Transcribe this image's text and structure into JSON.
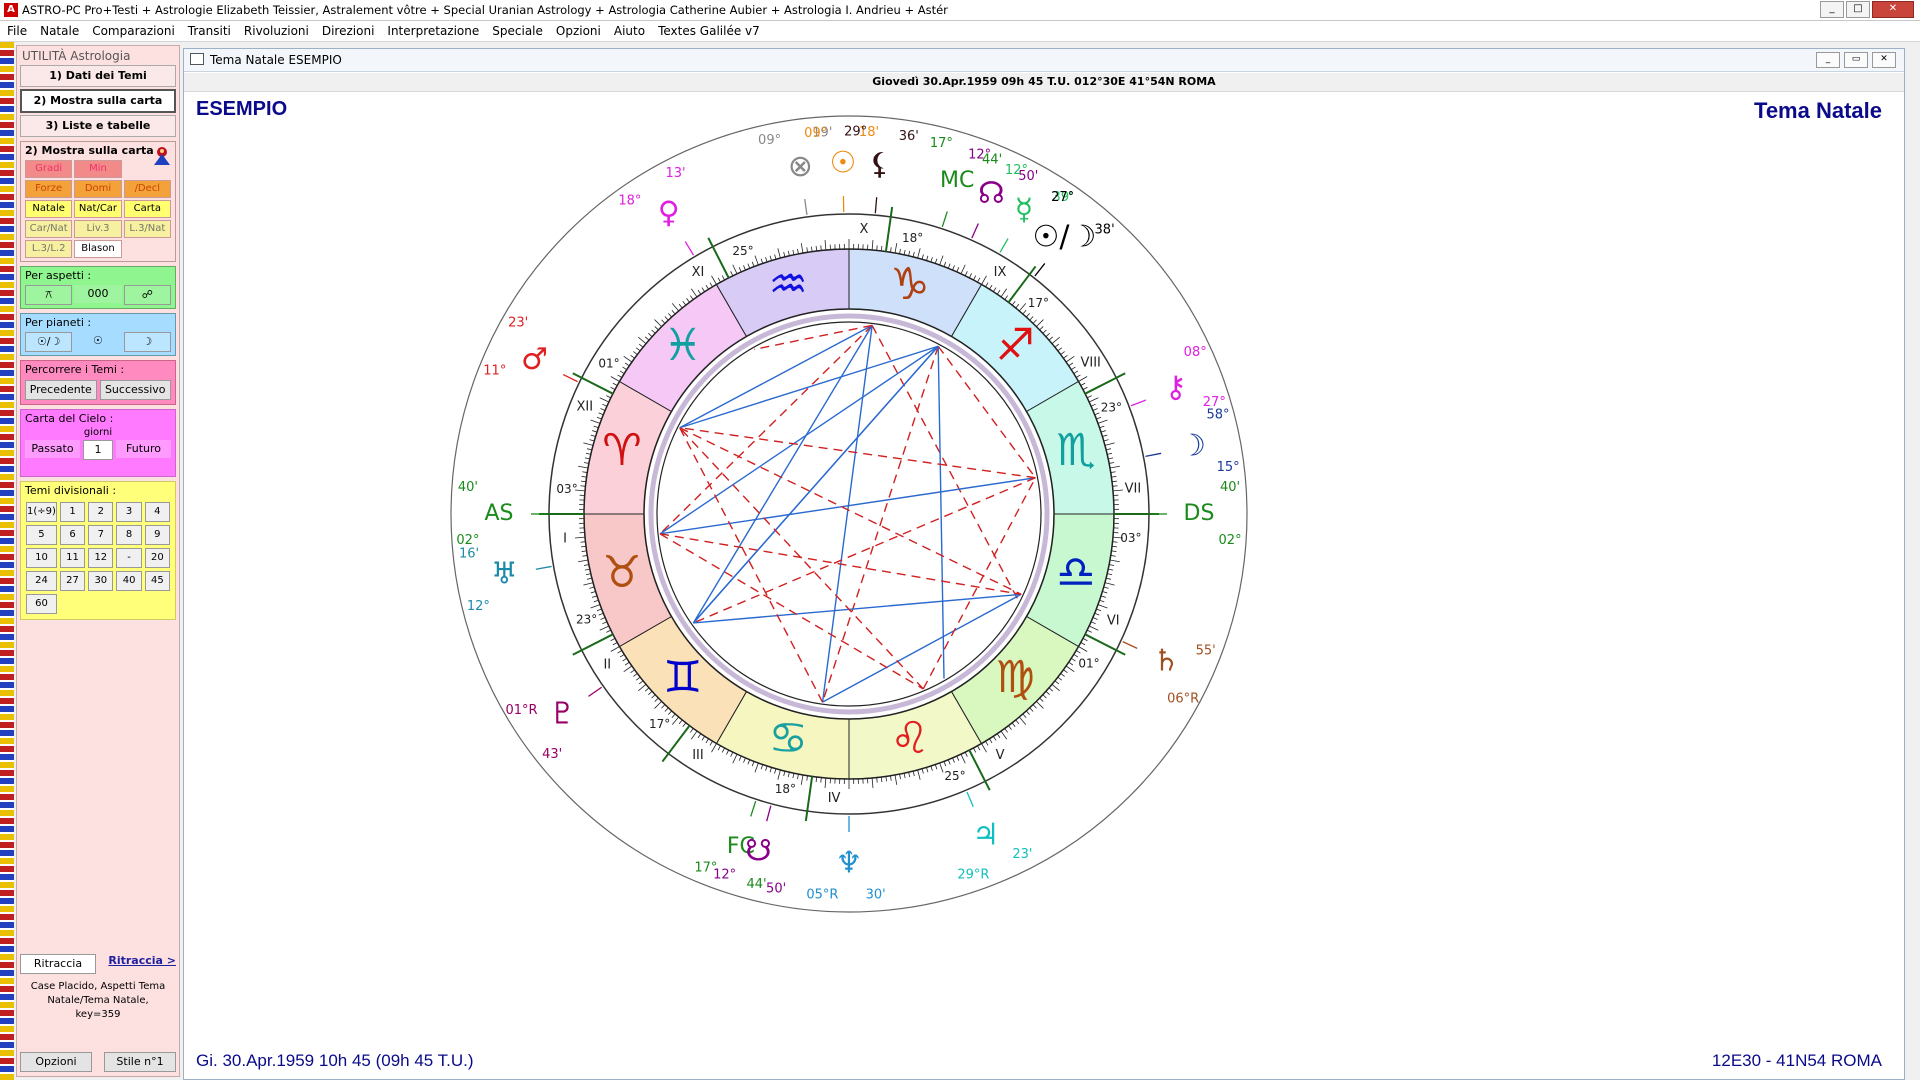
{
  "window": {
    "title": "ASTRO-PC Pro+Testi + Astrologie Elizabeth Teissier, Astralement vôtre + Special Uranian Astrology + Astrologia Catherine Aubier + Astrologia I. Andrieu + Astér",
    "controls": [
      "_",
      "□",
      "✕"
    ]
  },
  "menu": [
    {
      "label": "File"
    },
    {
      "label": "Natale"
    },
    {
      "label": "Comparazioni"
    },
    {
      "label": "Transiti"
    },
    {
      "label": "Rivoluzioni"
    },
    {
      "label": "Direzioni"
    },
    {
      "label": "Interpretazione"
    },
    {
      "label": "Speciale"
    },
    {
      "label": "Opzioni"
    },
    {
      "label": "Aiuto"
    },
    {
      "label": "Textes Galilée v7"
    }
  ],
  "sidebar": {
    "heading": "UTILITÀ Astrologia",
    "nav": [
      "1) Dati dei Temi",
      "2) Mostra sulla carta",
      "3) Liste e tabelle"
    ],
    "show_group_title": "2) Mostra sulla carta :",
    "show_buttons": [
      {
        "label": "Gradi",
        "style": "r"
      },
      {
        "label": "Min",
        "style": "r"
      },
      {
        "label": "",
        "style": "none"
      },
      {
        "label": "Forze",
        "style": "o"
      },
      {
        "label": "Domi",
        "style": "o"
      },
      {
        "label": "/Decl",
        "style": "o"
      },
      {
        "label": "Natale",
        "style": "y"
      },
      {
        "label": "Nat/Car",
        "style": "y"
      },
      {
        "label": "Carta",
        "style": "y"
      },
      {
        "label": "Car/Nat",
        "style": "yy"
      },
      {
        "label": "Liv.3",
        "style": "yy"
      },
      {
        "label": "L.3/Nat",
        "style": "yy"
      },
      {
        "label": "L.3/L.2",
        "style": "yy"
      },
      {
        "label": "Blason",
        "style": "w"
      },
      {
        "label": "",
        "style": "none"
      }
    ],
    "aspects": {
      "title": "Per aspetti :",
      "buttons": [
        "⚻",
        "000",
        "☍"
      ]
    },
    "planets": {
      "title": "Per pianeti :",
      "buttons": [
        "☉/☽",
        "☉",
        "☽"
      ]
    },
    "browse": {
      "title": "Percorrere i Temi :",
      "prev": "Precedente",
      "next": "Successivo"
    },
    "sky": {
      "title": "Carta del Cielo :",
      "unit": "giorni",
      "past": "Passato",
      "value": "1",
      "future": "Futuro"
    },
    "divisional": {
      "title": "Temi divisionali :",
      "buttons": [
        "1(÷9)",
        "1",
        "2",
        "3",
        "4",
        "5",
        "6",
        "7",
        "8",
        "9",
        "10",
        "11",
        "12",
        "-",
        "20",
        "24",
        "27",
        "30",
        "40",
        "45",
        "60"
      ]
    },
    "retrace": {
      "button": "Ritraccia",
      "link": "Ritraccia >"
    },
    "status": "Case Placido, Aspetti Tema Natale/Tema Natale, key=359",
    "options": "Opzioni",
    "style": "Stile n°1"
  },
  "chart_window": {
    "title": "Tema Natale  ESEMPIO",
    "info": "Giovedì 30.Apr.1959 09h 45 T.U. 012°30E 41°54N  ROMA",
    "name": "ESEMPIO",
    "type_label": "Tema Natale",
    "date_line": "Gi. 30.Apr.1959 10h 45 (09h 45 T.U.)",
    "coords": "12E30 - 41N54  ROMA"
  },
  "chart_data": {
    "type": "natal_wheel",
    "ascendant_deg": 122.67,
    "signs": [
      {
        "name": "Leone",
        "glyph": "♌",
        "color": "#e02020",
        "fill": "#f2f8c8"
      },
      {
        "name": "Cancro",
        "glyph": "♋",
        "color": "#1aa0a0",
        "fill": "#f6f6c0"
      },
      {
        "name": "Gemelli",
        "glyph": "♊",
        "color": "#0000cc",
        "fill": "#fbe1b8"
      },
      {
        "name": "Toro",
        "glyph": "♉",
        "color": "#b05010",
        "fill": "#f8c8c8"
      },
      {
        "name": "Ariete",
        "glyph": "♈",
        "color": "#d01010",
        "fill": "#fbd0d8"
      },
      {
        "name": "Pesci",
        "glyph": "♓",
        "color": "#11a0a0",
        "fill": "#f5c8f5"
      },
      {
        "name": "Acquario",
        "glyph": "♒",
        "color": "#1010e0",
        "fill": "#d8cbf5"
      },
      {
        "name": "Capricorno",
        "glyph": "♑",
        "color": "#b04010",
        "fill": "#cfe0fb"
      },
      {
        "name": "Sagittario",
        "glyph": "♐",
        "color": "#e01010",
        "fill": "#c9f3fb"
      },
      {
        "name": "Scorpione",
        "glyph": "♏",
        "color": "#11a0a0",
        "fill": "#c8f8e8"
      },
      {
        "name": "Bilancia",
        "glyph": "♎",
        "color": "#0020c0",
        "fill": "#c8f8d0"
      },
      {
        "name": "Vergine",
        "glyph": "♍",
        "color": "#b05010",
        "fill": "#d8f8c0"
      }
    ],
    "house_cusps": [
      {
        "label": "I",
        "angle": 180,
        "deg": "03°"
      },
      {
        "label": "II",
        "angle": 207,
        "deg": "23°"
      },
      {
        "label": "III",
        "angle": 233,
        "deg": "17°"
      },
      {
        "label": "IV",
        "angle": 262,
        "deg": "18°"
      },
      {
        "label": "V",
        "angle": 297,
        "deg": "25°"
      },
      {
        "label": "VI",
        "angle": 333,
        "deg": "01°"
      },
      {
        "label": "VII",
        "angle": 0,
        "deg": "03°"
      },
      {
        "label": "VIII",
        "angle": 27,
        "deg": "23°"
      },
      {
        "label": "IX",
        "angle": 53,
        "deg": "17°"
      },
      {
        "label": "X",
        "angle": 82,
        "deg": "18°"
      },
      {
        "label": "XI",
        "angle": 117,
        "deg": "25°"
      },
      {
        "label": "XII",
        "angle": 153,
        "deg": "01°"
      }
    ],
    "planets": [
      {
        "name": "Ascendente",
        "glyph": "AS",
        "angle": 180,
        "deg": "02°",
        "min": "40'",
        "color": "#1a8a1a"
      },
      {
        "name": "Discendente",
        "glyph": "DS",
        "angle": 0,
        "deg": "40'",
        "min": "02°",
        "color": "#1a8a1a"
      },
      {
        "name": "Medio Cielo",
        "glyph": "MC",
        "angle": 72,
        "deg": "17°",
        "min": "44'",
        "color": "#1a8a1a"
      },
      {
        "name": "Fondo Cielo",
        "glyph": "FC",
        "angle": 252,
        "deg": "44'",
        "min": "17°",
        "color": "#1a8a1a"
      },
      {
        "name": "Fortuna",
        "glyph": "⊗",
        "angle": 98,
        "deg": "09°",
        "min": "19'",
        "color": "#888888"
      },
      {
        "name": "Sole",
        "glyph": "☉",
        "angle": 91,
        "deg": "09°",
        "min": "18'",
        "color": "#ee8a10"
      },
      {
        "name": "Luna nera",
        "glyph": "⚸",
        "angle": 85,
        "deg": "29°",
        "min": "36'",
        "color": "#331111"
      },
      {
        "name": "Nodo Nord",
        "glyph": "☊",
        "angle": 66,
        "deg": "12°",
        "min": "50'",
        "color": "#880088"
      },
      {
        "name": "Mercurio",
        "glyph": "☿",
        "angle": 60,
        "deg": "12°",
        "min": "39'",
        "color": "#20c060"
      },
      {
        "name": "Sole/Luna",
        "glyph": "☉/☽",
        "angle": 52,
        "deg": "27°",
        "min": "38'",
        "color": "#000000"
      },
      {
        "name": "Venere",
        "glyph": "♀",
        "angle": 121,
        "deg": "18°",
        "min": "13'",
        "color": "#e020e0"
      },
      {
        "name": "Chirone",
        "glyph": "⚷",
        "angle": 21,
        "deg": "08°",
        "min": "27°",
        "color": "#e020e0"
      },
      {
        "name": "Marte",
        "glyph": "♂",
        "angle": 154,
        "deg": "11°",
        "min": "23'",
        "color": "#e02020"
      },
      {
        "name": "Luna",
        "glyph": "☽",
        "angle": 11,
        "deg": "58°",
        "min": "15°",
        "color": "#1a3a9a"
      },
      {
        "name": "Urano",
        "glyph": "♅",
        "angle": 190,
        "deg": "12°",
        "min": "16'",
        "color": "#1a8aaa"
      },
      {
        "name": "Saturno",
        "glyph": "♄",
        "angle": 335,
        "deg": "55'",
        "min": "06°R",
        "color": "#a05020"
      },
      {
        "name": "Plutone",
        "glyph": "♇",
        "angle": 215,
        "deg": "43'",
        "min": "01°R",
        "color": "#990066"
      },
      {
        "name": "Nodo Sud",
        "glyph": "☋",
        "angle": 255,
        "deg": "50'",
        "min": "12°",
        "color": "#880088"
      },
      {
        "name": "Nettuno",
        "glyph": "♆",
        "angle": 270,
        "deg": "30'",
        "min": "05°R",
        "color": "#2090d0"
      },
      {
        "name": "Giove",
        "glyph": "♃",
        "angle": 293,
        "deg": "23'",
        "min": "29°R",
        "color": "#10c0c0"
      }
    ],
    "aspects": [
      {
        "a": 83,
        "b": 153,
        "kind": "blue"
      },
      {
        "a": 83,
        "b": 262,
        "kind": "blue"
      },
      {
        "a": 83,
        "b": 333,
        "kind": "red"
      },
      {
        "a": 83,
        "b": 186,
        "kind": "red"
      },
      {
        "a": 83,
        "b": 215,
        "kind": "blue"
      },
      {
        "a": 83,
        "b": 120,
        "kind": "red"
      },
      {
        "a": 62,
        "b": 153,
        "kind": "blue"
      },
      {
        "a": 62,
        "b": 215,
        "kind": "blue"
      },
      {
        "a": 62,
        "b": 186,
        "kind": "blue"
      },
      {
        "a": 62,
        "b": 11,
        "kind": "red"
      },
      {
        "a": 62,
        "b": 262,
        "kind": "red"
      },
      {
        "a": 62,
        "b": 300,
        "kind": "blue"
      },
      {
        "a": 11,
        "b": 186,
        "kind": "blue"
      },
      {
        "a": 11,
        "b": 153,
        "kind": "red"
      },
      {
        "a": 11,
        "b": 215,
        "kind": "red"
      },
      {
        "a": 215,
        "b": 335,
        "kind": "blue"
      },
      {
        "a": 262,
        "b": 335,
        "kind": "blue"
      },
      {
        "a": 262,
        "b": 153,
        "kind": "red"
      },
      {
        "a": 153,
        "b": 335,
        "kind": "red"
      },
      {
        "a": 186,
        "b": 335,
        "kind": "red"
      },
      {
        "a": 186,
        "b": 293,
        "kind": "red"
      },
      {
        "a": 215,
        "b": 62,
        "kind": "blue"
      },
      {
        "a": 293,
        "b": 153,
        "kind": "red"
      },
      {
        "a": 293,
        "b": 11,
        "kind": "red"
      }
    ]
  }
}
